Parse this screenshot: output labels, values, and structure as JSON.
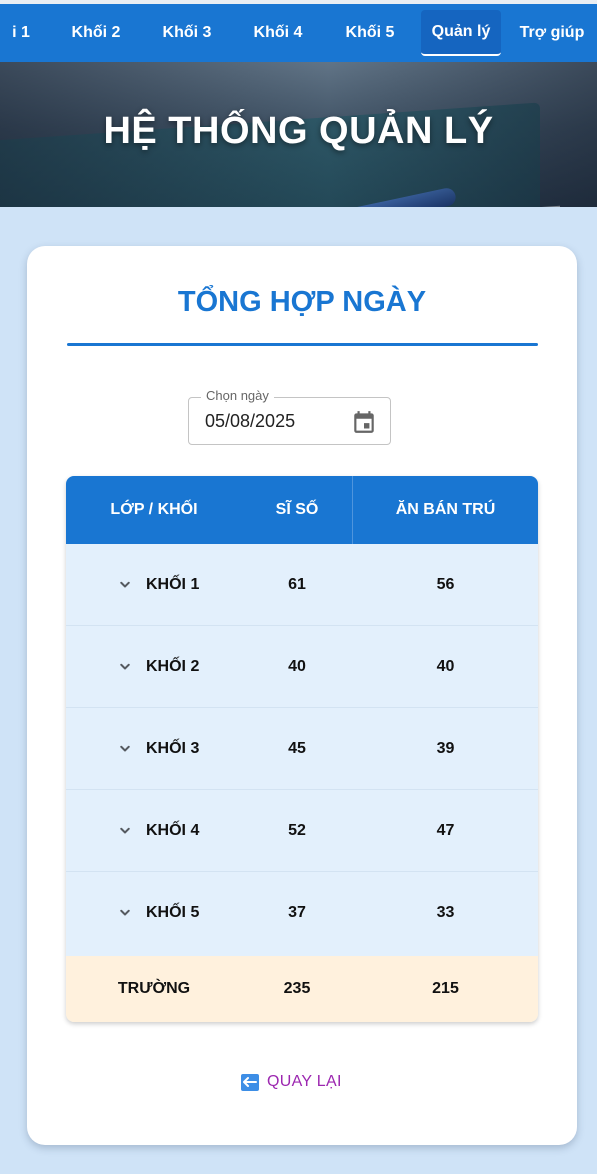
{
  "nav": {
    "items": [
      {
        "label": "i 1"
      },
      {
        "label": "Khối 2"
      },
      {
        "label": "Khối 3"
      },
      {
        "label": "Khối 4"
      },
      {
        "label": "Khối 5"
      },
      {
        "label": "Quản lý"
      },
      {
        "label": "Trợ giúp"
      }
    ],
    "active": "Quản lý"
  },
  "hero": {
    "title": "HỆ THỐNG QUẢN LÝ"
  },
  "card": {
    "title": "TỔNG HỢP NGÀY",
    "date_field": {
      "label": "Chọn ngày",
      "value": "05/08/2025"
    },
    "table": {
      "headers": [
        "LỚP / KHỐI",
        "SĨ SỐ",
        "ĂN BÁN TRÚ"
      ],
      "rows": [
        {
          "group": "KHỐI 1",
          "si_so": "61",
          "ban_tru": "56"
        },
        {
          "group": "KHỐI 2",
          "si_so": "40",
          "ban_tru": "40"
        },
        {
          "group": "KHỐI 3",
          "si_so": "45",
          "ban_tru": "39"
        },
        {
          "group": "KHỐI 4",
          "si_so": "52",
          "ban_tru": "47"
        },
        {
          "group": "KHỐI 5",
          "si_so": "37",
          "ban_tru": "33"
        }
      ],
      "total": {
        "label": "TRƯỜNG",
        "si_so": "235",
        "ban_tru": "215"
      }
    },
    "back_label": "QUAY LẠI"
  },
  "colors": {
    "primary": "#1976d2",
    "background": "#cfe3f7",
    "row_bg": "#e3f0fc",
    "total_bg": "#fff1dd",
    "back_text": "#9c27b0"
  },
  "icons": [
    "calendar-icon",
    "chevron-down-icon",
    "back-arrow-icon"
  ]
}
